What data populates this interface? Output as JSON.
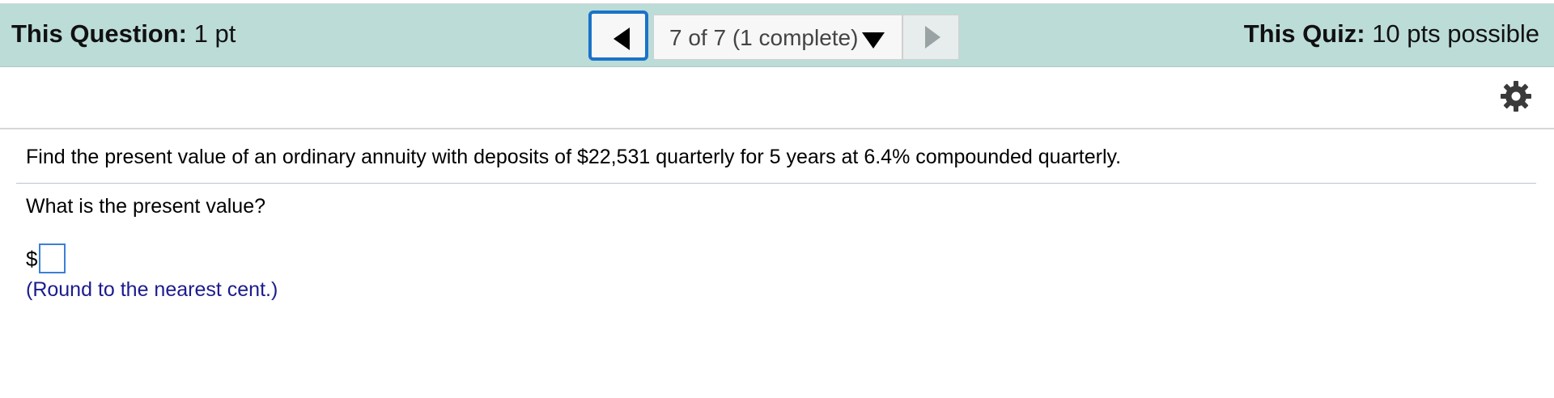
{
  "header": {
    "question_label": "This Question:",
    "question_points": "1 pt",
    "quiz_label": "This Quiz:",
    "quiz_points": "10 pts possible"
  },
  "navigation": {
    "prev_icon": "left-triangle-icon",
    "selector_text": "7 of 7 (1 complete)",
    "selector_icon": "caret-down-icon",
    "next_icon": "right-triangle-icon"
  },
  "toolbar": {
    "settings_icon": "gear-icon"
  },
  "question": {
    "prompt": "Find the present value of an ordinary annuity with deposits of $22,531 quarterly for 5 years at 6.4% compounded quarterly.",
    "ask": "What is the present value?",
    "currency_symbol": "$",
    "answer_value": "",
    "hint": "(Round to the nearest cent.)"
  },
  "colors": {
    "header_bg": "#bcdcd8",
    "focus_border": "#1a73c8",
    "hint_text": "#1b1b8f"
  }
}
